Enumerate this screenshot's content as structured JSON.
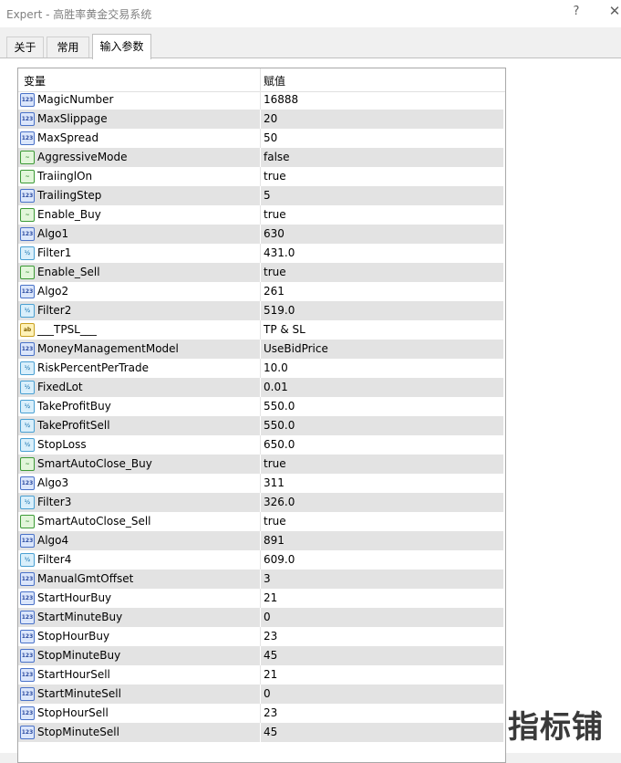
{
  "window": {
    "title": "Expert - 高胜率黄金交易系统",
    "help_label": "?",
    "close_label": "✕"
  },
  "tabs": [
    {
      "label": "关于"
    },
    {
      "label": "常用"
    },
    {
      "label": "输入参数"
    }
  ],
  "table": {
    "col_variable": "变量",
    "col_value": "赋值",
    "rows": [
      {
        "type": "int",
        "name": "MagicNumber",
        "value": "16888"
      },
      {
        "type": "int",
        "name": "MaxSlippage",
        "value": "20"
      },
      {
        "type": "int",
        "name": "MaxSpread",
        "value": "50"
      },
      {
        "type": "bool",
        "name": "AggressiveMode",
        "value": "false"
      },
      {
        "type": "bool",
        "name": "TraiinglOn",
        "value": "true"
      },
      {
        "type": "int",
        "name": "TrailingStep",
        "value": "5"
      },
      {
        "type": "bool",
        "name": "Enable_Buy",
        "value": "true"
      },
      {
        "type": "int",
        "name": "Algo1",
        "value": "630"
      },
      {
        "type": "double",
        "name": "Filter1",
        "value": "431.0"
      },
      {
        "type": "bool",
        "name": "Enable_Sell",
        "value": "true"
      },
      {
        "type": "int",
        "name": "Algo2",
        "value": "261"
      },
      {
        "type": "double",
        "name": "Filter2",
        "value": "519.0"
      },
      {
        "type": "string",
        "name": "___TPSL___",
        "value": "TP & SL"
      },
      {
        "type": "int",
        "name": "MoneyManagementModel",
        "value": "UseBidPrice"
      },
      {
        "type": "double",
        "name": "RiskPercentPerTrade",
        "value": "10.0"
      },
      {
        "type": "double",
        "name": "FixedLot",
        "value": "0.01"
      },
      {
        "type": "double",
        "name": "TakeProfitBuy",
        "value": "550.0"
      },
      {
        "type": "double",
        "name": "TakeProfitSell",
        "value": "550.0"
      },
      {
        "type": "double",
        "name": "StopLoss",
        "value": "650.0"
      },
      {
        "type": "bool",
        "name": "SmartAutoClose_Buy",
        "value": "true"
      },
      {
        "type": "int",
        "name": "Algo3",
        "value": "311"
      },
      {
        "type": "double",
        "name": "Filter3",
        "value": "326.0"
      },
      {
        "type": "bool",
        "name": "SmartAutoClose_Sell",
        "value": "true"
      },
      {
        "type": "int",
        "name": "Algo4",
        "value": "891"
      },
      {
        "type": "double",
        "name": "Filter4",
        "value": "609.0"
      },
      {
        "type": "int",
        "name": "ManualGmtOffset",
        "value": "3"
      },
      {
        "type": "int",
        "name": "StartHourBuy",
        "value": "21"
      },
      {
        "type": "int",
        "name": "StartMinuteBuy",
        "value": "0"
      },
      {
        "type": "int",
        "name": "StopHourBuy",
        "value": "23"
      },
      {
        "type": "int",
        "name": "StopMinuteBuy",
        "value": "45"
      },
      {
        "type": "int",
        "name": "StartHourSell",
        "value": "21"
      },
      {
        "type": "int",
        "name": "StartMinuteSell",
        "value": "0"
      },
      {
        "type": "int",
        "name": "StopHourSell",
        "value": "23"
      },
      {
        "type": "int",
        "name": "StopMinuteSell",
        "value": "45"
      }
    ]
  },
  "icons": {
    "int": "123",
    "bool": "~",
    "double": "½",
    "string": "ab"
  },
  "watermark": "指标铺"
}
